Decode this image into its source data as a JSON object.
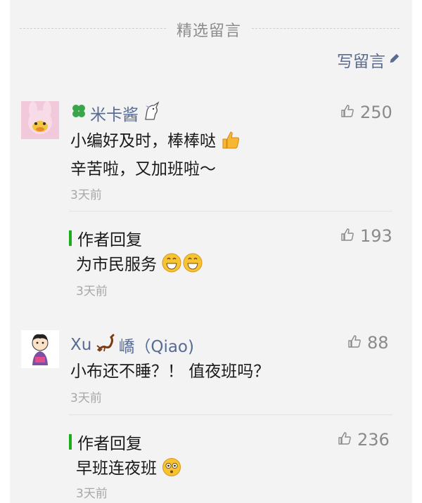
{
  "section": {
    "title": "精选留言"
  },
  "write_comment": {
    "label": "写留言",
    "icon": "pencil-icon"
  },
  "colors": {
    "name": "#576b95",
    "reply_bar": "#1aad19",
    "panel": "#f3f3f3"
  },
  "comments": [
    {
      "name": "米卡酱",
      "name_prefix_icon": "four-leaf-clover-icon",
      "name_suffix_icon": "unicorn-icon",
      "lines": [
        "小编好及时，棒棒哒",
        "辛苦啦，又加班啦～"
      ],
      "line1_emoji": "thumbs-up-emoji",
      "time": "3天前",
      "likes": "250",
      "reply": {
        "label": "作者回复",
        "text": "为市民服务",
        "emoji": "grinning-face-emoji",
        "time": "3天前",
        "likes": "193"
      }
    },
    {
      "name_part1": "Xu",
      "name_icon": "scorpion-icon",
      "name_part2": "嶠（Qiao)",
      "text": "小布还不睡？！ 值夜班吗？",
      "time": "3天前",
      "likes": "88",
      "reply": {
        "label": "作者回复",
        "text": "早班连夜班",
        "emoji": "flushed-face-emoji",
        "time": "3天前",
        "likes": "236"
      }
    }
  ]
}
